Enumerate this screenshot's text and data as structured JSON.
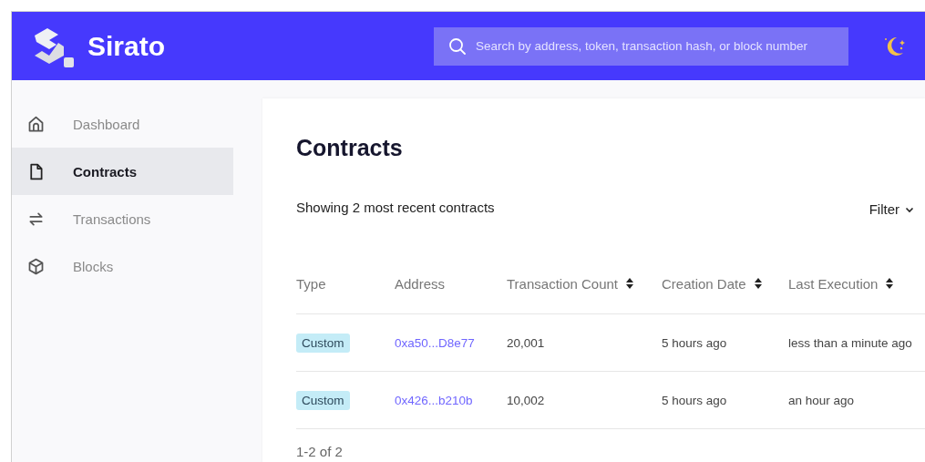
{
  "header": {
    "brand": "Sirato",
    "search": {
      "placeholder": "Search by address, token, transaction hash, or block number"
    }
  },
  "sidebar": {
    "items": [
      {
        "label": "Dashboard",
        "selected": false
      },
      {
        "label": "Contracts",
        "selected": true
      },
      {
        "label": "Transactions",
        "selected": false
      },
      {
        "label": "Blocks",
        "selected": false
      }
    ]
  },
  "page": {
    "title": "Contracts",
    "summary": "Showing 2 most recent contracts",
    "filter": "Filter"
  },
  "table": {
    "columns": [
      {
        "label": "Type",
        "sortable": false
      },
      {
        "label": "Address",
        "sortable": false
      },
      {
        "label": "Transaction Count",
        "sortable": true
      },
      {
        "label": "Creation Date",
        "sortable": true
      },
      {
        "label": "Last Execution",
        "sortable": true
      }
    ],
    "rows": [
      {
        "type": "Custom",
        "address": "0xa50...D8e77",
        "transaction_count": "20,001",
        "creation_date": "5 hours ago",
        "last_execution": "less than a minute ago"
      },
      {
        "type": "Custom",
        "address": "0x426...b210b",
        "transaction_count": "10,002",
        "creation_date": "5 hours ago",
        "last_execution": "an hour ago"
      }
    ]
  },
  "pagination": "1-2 of 2"
}
